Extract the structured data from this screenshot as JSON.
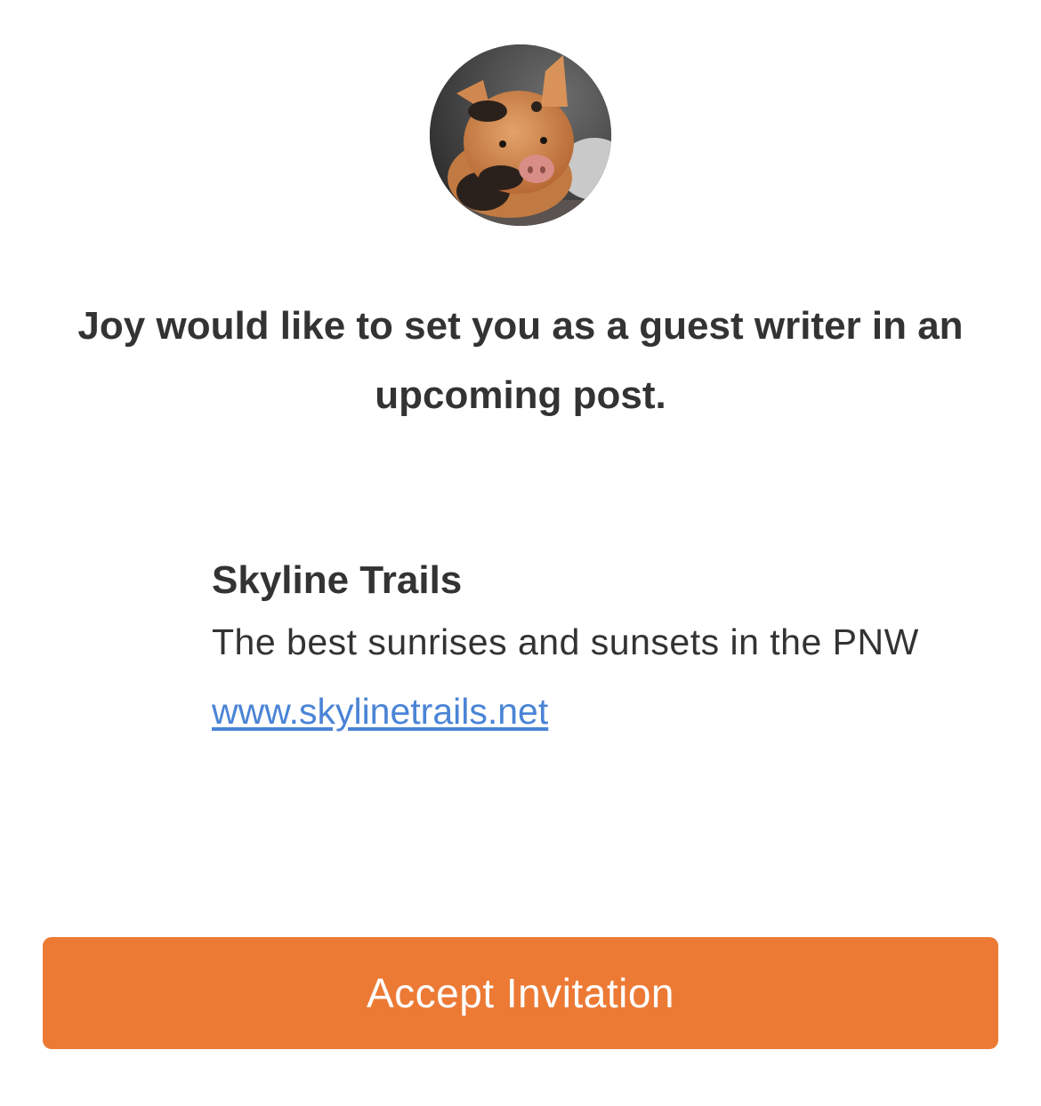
{
  "inviter": {
    "avatar_icon": "pig-avatar",
    "message": "Joy would like to set you as a guest writer in an upcoming post."
  },
  "publication": {
    "name": "Skyline Trails",
    "description": "The best sunrises and sunsets in the PNW",
    "url": "www.skylinetrails.net"
  },
  "actions": {
    "accept_label": "Accept Invitation"
  },
  "colors": {
    "accent": "#ec7a35",
    "link": "#4a84d6",
    "text": "#333333"
  }
}
